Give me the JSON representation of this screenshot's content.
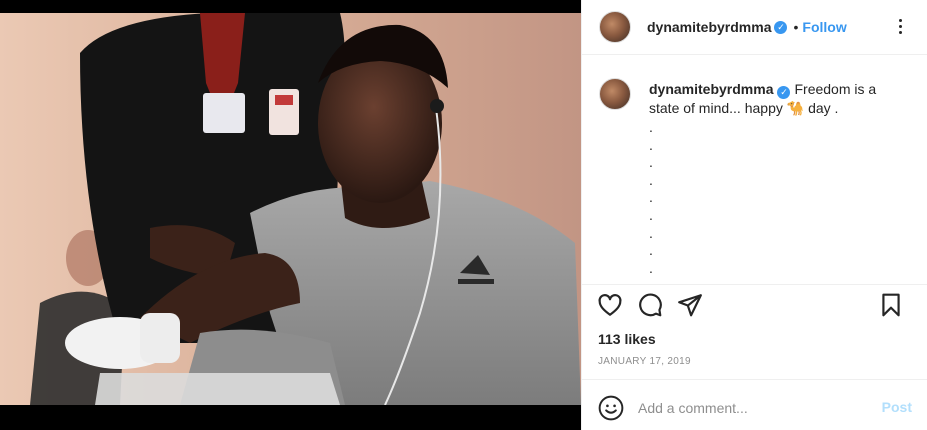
{
  "header": {
    "username": "dynamitebyrdmma",
    "separator": "•",
    "follow_label": "Follow",
    "verified_glyph": "✓"
  },
  "caption": {
    "username": "dynamitebyrdmma",
    "text_before_emoji": "Freedom is a state of mind... happy",
    "emoji": "🐪",
    "text_after_emoji": "day .",
    "trailing_dots": [
      ".",
      ".",
      ".",
      ".",
      ".",
      ".",
      ".",
      ".",
      "."
    ]
  },
  "post": {
    "likes": "113 likes",
    "date": "JANUARY 17, 2019"
  },
  "comment": {
    "placeholder": "Add a comment...",
    "post_label": "Post"
  },
  "icons": {
    "like": "heart-icon",
    "comment": "comment-icon",
    "share": "share-icon",
    "save": "bookmark-icon",
    "more": "more-options-icon",
    "emoji": "emoji-icon"
  },
  "colors": {
    "accent": "#3897f0",
    "post_disabled": "#b2dffc",
    "text": "#262626",
    "muted": "#8e8e8e",
    "divider": "#efefef"
  }
}
